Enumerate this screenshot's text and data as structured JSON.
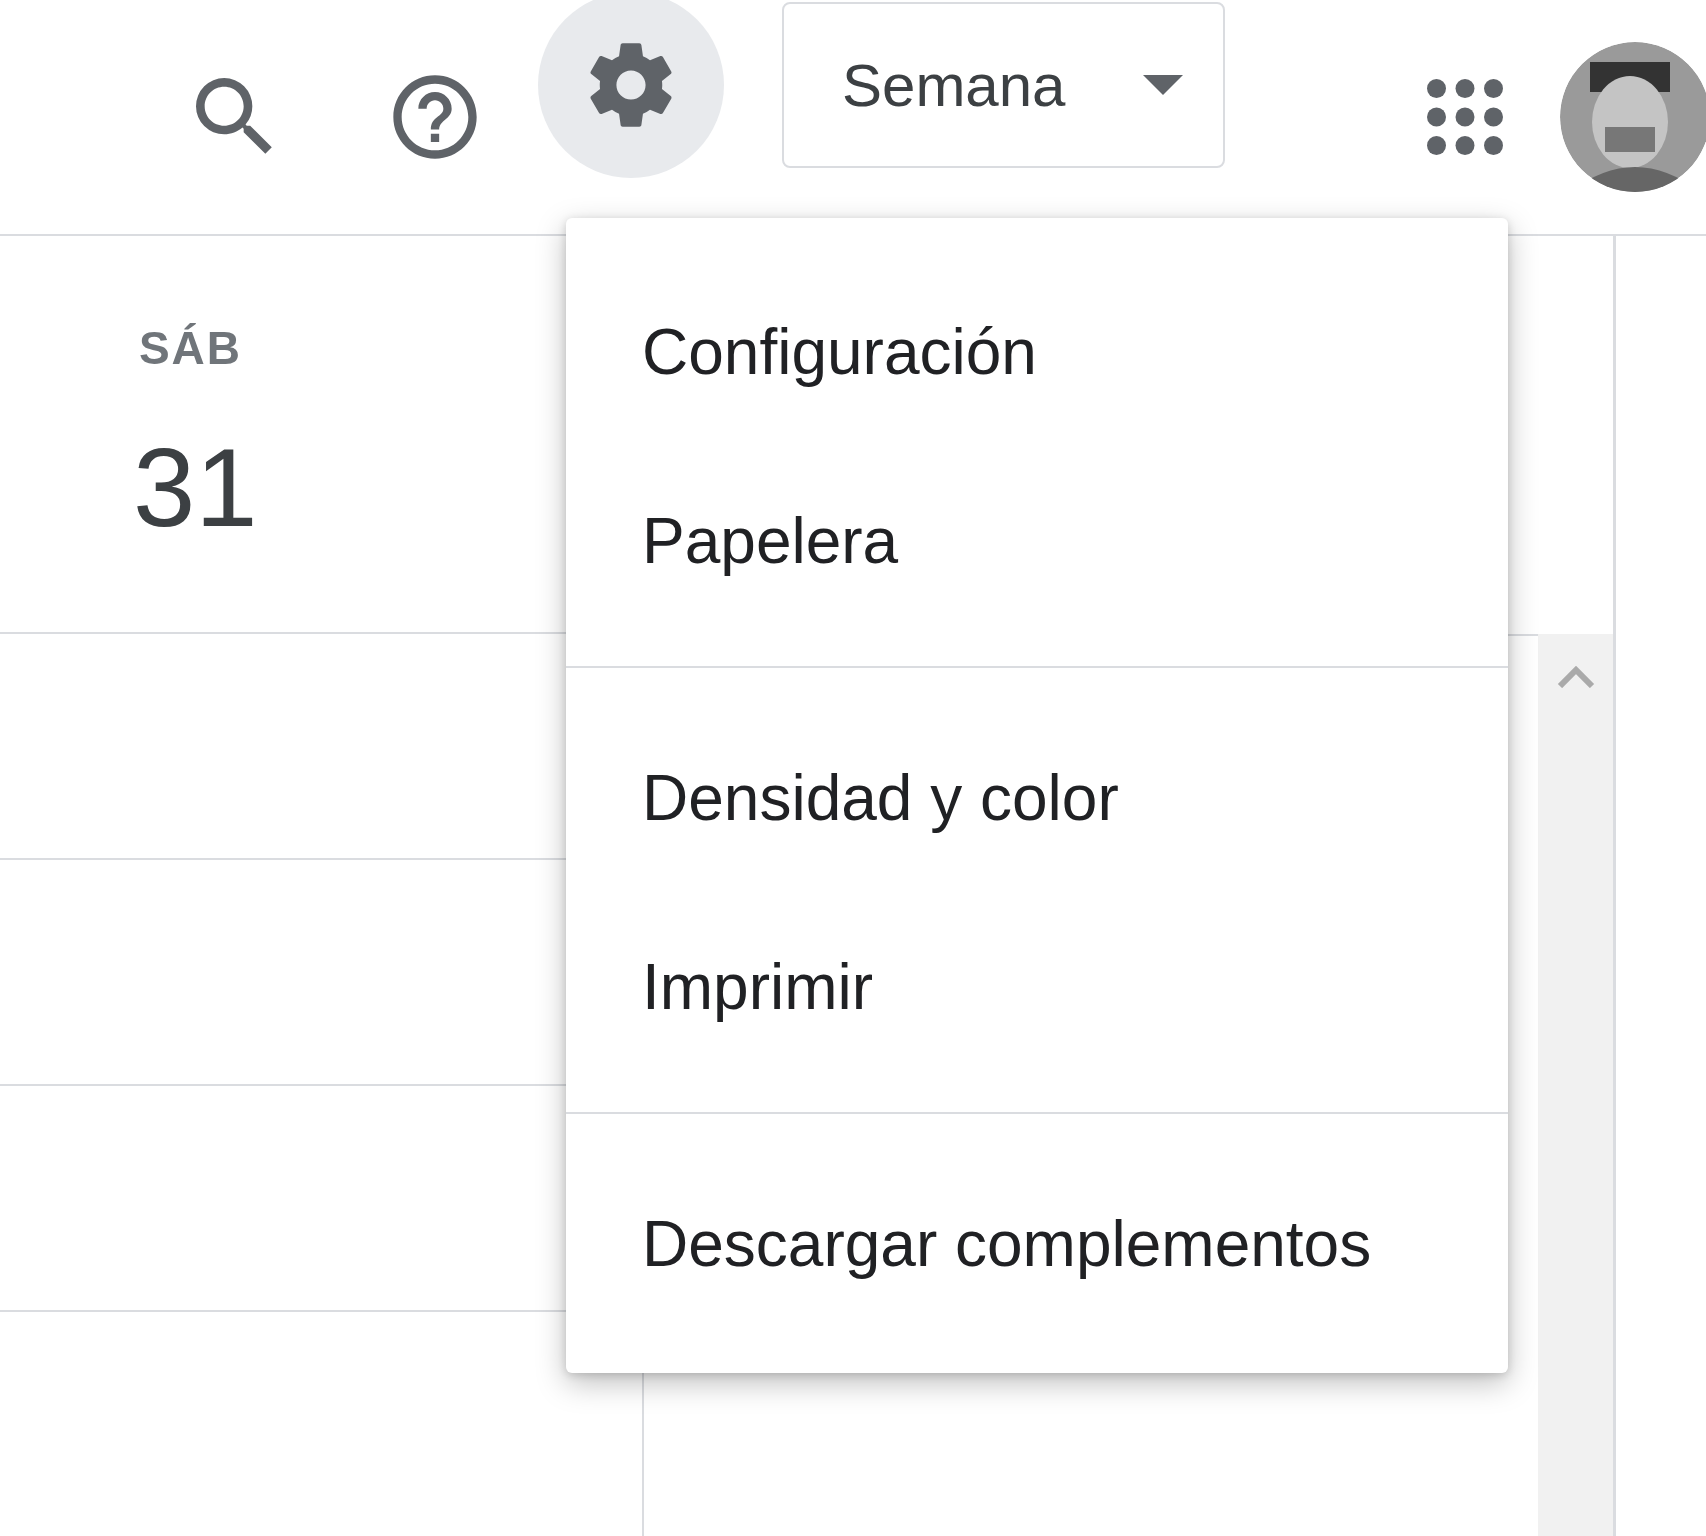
{
  "toolbar": {
    "settings_open": true,
    "view_selector": "Semana"
  },
  "day": {
    "weekday": "SÁB",
    "date": "31"
  },
  "settings_menu": {
    "groups": [
      [
        "Configuración",
        "Papelera"
      ],
      [
        "Densidad y color",
        "Imprimir"
      ],
      [
        "Descargar complementos"
      ]
    ]
  }
}
